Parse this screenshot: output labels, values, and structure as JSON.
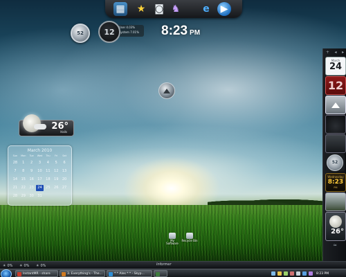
{
  "topdock": {
    "icons": [
      "photo-icon",
      "star-icon",
      "camera-icon",
      "wizard-icon",
      "ie-icon",
      "media-player-icon"
    ]
  },
  "gadgets": {
    "analog_clock_1": {
      "value": "52"
    },
    "sysmon": {
      "value": "12",
      "line1": "User 4.03%",
      "line2": "System 7.01%"
    },
    "digital_clock": {
      "time": "8:23",
      "ampm": "PM"
    },
    "weather": {
      "temp": "26°",
      "city": "Halls"
    },
    "calendar": {
      "title": "March 2010",
      "weekdays": [
        "Sun",
        "Mon",
        "Tue",
        "Wed",
        "Thu",
        "Fri",
        "Sat"
      ],
      "days": [
        "28",
        "1",
        "2",
        "3",
        "4",
        "5",
        "6",
        "7",
        "8",
        "9",
        "10",
        "11",
        "12",
        "13",
        "14",
        "15",
        "16",
        "17",
        "18",
        "19",
        "20",
        "21",
        "22",
        "23",
        "24",
        "25",
        "26",
        "27",
        "28",
        "29",
        "30",
        "31",
        "",
        "",
        ""
      ],
      "today_index": 24
    }
  },
  "sidebar": {
    "top_buttons": [
      "+",
      "◂",
      "▸"
    ],
    "calendar_month": "March",
    "calendar_day": "24",
    "counter": "12",
    "clock_value": "52",
    "time_day": "Wednesday",
    "time": "8:23",
    "ampm": "PM",
    "weather_temp": "26°",
    "bottom_button": "≈"
  },
  "desktop_icons": [
    {
      "label": "My"
    },
    {
      "label": "Recycle Bin"
    },
    {
      "label": "Software"
    }
  ],
  "quickbar": {
    "left_items": [
      "☀",
      "0%",
      "☀",
      "0%",
      "☀",
      "0%"
    ],
    "center": "Informer"
  },
  "taskbar": {
    "tasks": [
      {
        "label": "InstantMR - share",
        "color": "#c83a2a"
      },
      {
        "label": "3. Everything's - The...",
        "color": "#d07a20"
      },
      {
        "label": "* * Ales * * - Skyp...",
        "color": "#2e8fd6"
      },
      {
        "label": "",
        "color": "#3d7b3d"
      }
    ],
    "tray_time": "8:23 PM",
    "colors": {
      "accent": "#1b5fb0"
    }
  }
}
